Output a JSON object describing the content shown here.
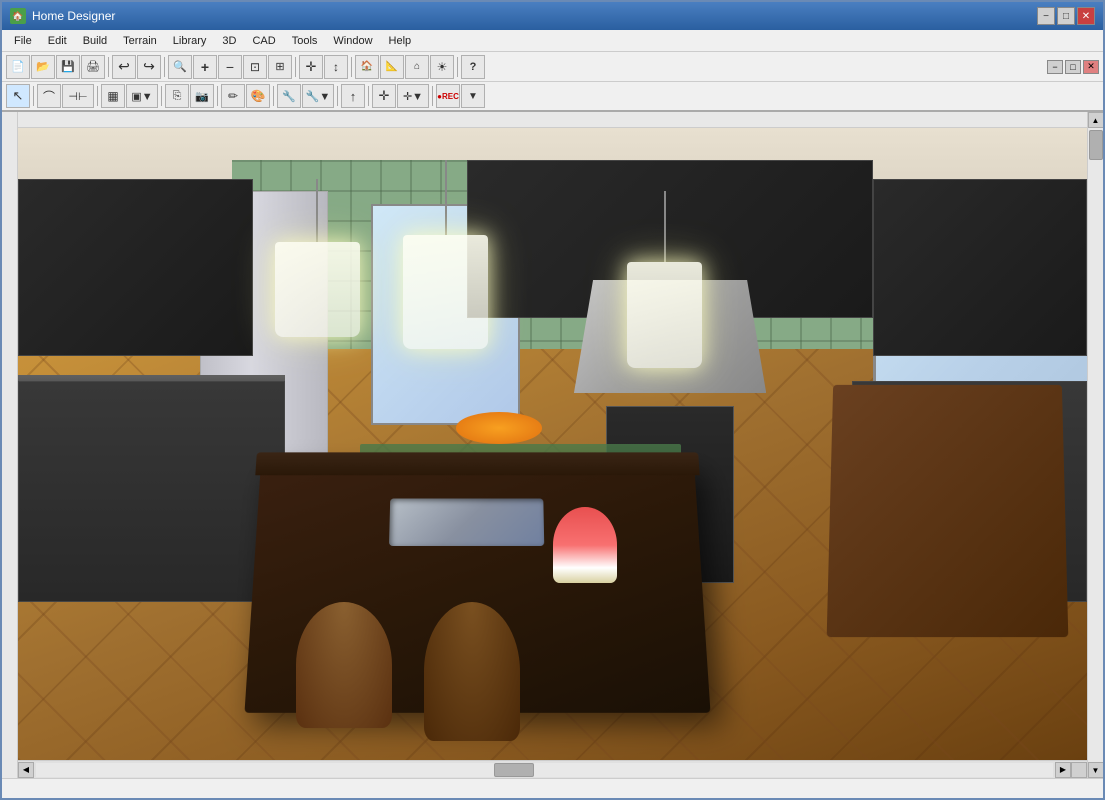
{
  "window": {
    "title": "Home Designer",
    "icon": "🏠"
  },
  "titlebar": {
    "title": "Home Designer",
    "min_label": "−",
    "max_label": "□",
    "close_label": "✕"
  },
  "menubar": {
    "items": [
      {
        "id": "file",
        "label": "File"
      },
      {
        "id": "edit",
        "label": "Edit"
      },
      {
        "id": "build",
        "label": "Build"
      },
      {
        "id": "terrain",
        "label": "Terrain"
      },
      {
        "id": "library",
        "label": "Library"
      },
      {
        "id": "3d",
        "label": "3D"
      },
      {
        "id": "cad",
        "label": "CAD"
      },
      {
        "id": "tools",
        "label": "Tools"
      },
      {
        "id": "window",
        "label": "Window"
      },
      {
        "id": "help",
        "label": "Help"
      }
    ]
  },
  "toolbar1": {
    "buttons": [
      {
        "id": "new",
        "icon": "📄",
        "tooltip": "New"
      },
      {
        "id": "open",
        "icon": "📂",
        "tooltip": "Open"
      },
      {
        "id": "save",
        "icon": "💾",
        "tooltip": "Save"
      },
      {
        "id": "print",
        "icon": "🖨",
        "tooltip": "Print"
      },
      {
        "id": "undo",
        "icon": "↩",
        "tooltip": "Undo"
      },
      {
        "id": "redo",
        "icon": "↪",
        "tooltip": "Redo"
      },
      {
        "id": "zoom-in",
        "icon": "🔍",
        "tooltip": "Zoom In"
      },
      {
        "id": "zoom-out",
        "icon": "🔍",
        "tooltip": "Zoom Out"
      },
      {
        "id": "zoom-fit",
        "icon": "⊡",
        "tooltip": "Fit to Window"
      },
      {
        "id": "zoom-all",
        "icon": "⊞",
        "tooltip": "Zoom All"
      },
      {
        "id": "nav",
        "icon": "✛",
        "tooltip": "Navigate"
      },
      {
        "id": "up",
        "icon": "▲",
        "tooltip": "Up"
      },
      {
        "id": "house",
        "icon": "🏠",
        "tooltip": "House View"
      },
      {
        "id": "camera",
        "icon": "📷",
        "tooltip": "Camera"
      },
      {
        "id": "help",
        "icon": "?",
        "tooltip": "Help"
      }
    ]
  },
  "toolbar2": {
    "buttons": [
      {
        "id": "select",
        "icon": "↖",
        "tooltip": "Select"
      },
      {
        "id": "polyline",
        "icon": "⌒",
        "tooltip": "Polyline"
      },
      {
        "id": "measure",
        "icon": "⊣",
        "tooltip": "Measure"
      },
      {
        "id": "block",
        "icon": "▦",
        "tooltip": "Block"
      },
      {
        "id": "cabinet",
        "icon": "▣",
        "tooltip": "Cabinet"
      },
      {
        "id": "copy",
        "icon": "⎘",
        "tooltip": "Copy"
      },
      {
        "id": "camera2",
        "icon": "📷",
        "tooltip": "Camera"
      },
      {
        "id": "paint",
        "icon": "✏",
        "tooltip": "Paint"
      },
      {
        "id": "color",
        "icon": "🎨",
        "tooltip": "Color"
      },
      {
        "id": "tools2",
        "icon": "🔧",
        "tooltip": "Tools"
      },
      {
        "id": "arrow-up",
        "icon": "↑",
        "tooltip": "Arrow Up"
      },
      {
        "id": "cross",
        "icon": "✛",
        "tooltip": "Cross"
      },
      {
        "id": "rec",
        "icon": "⏺",
        "tooltip": "Record"
      }
    ]
  },
  "viewport": {
    "scene_description": "3D kitchen render showing dark cabinets, green tile backsplash, hardwood floors, kitchen island with sink, pendant lights, dining area"
  },
  "statusbar": {
    "text": ""
  }
}
